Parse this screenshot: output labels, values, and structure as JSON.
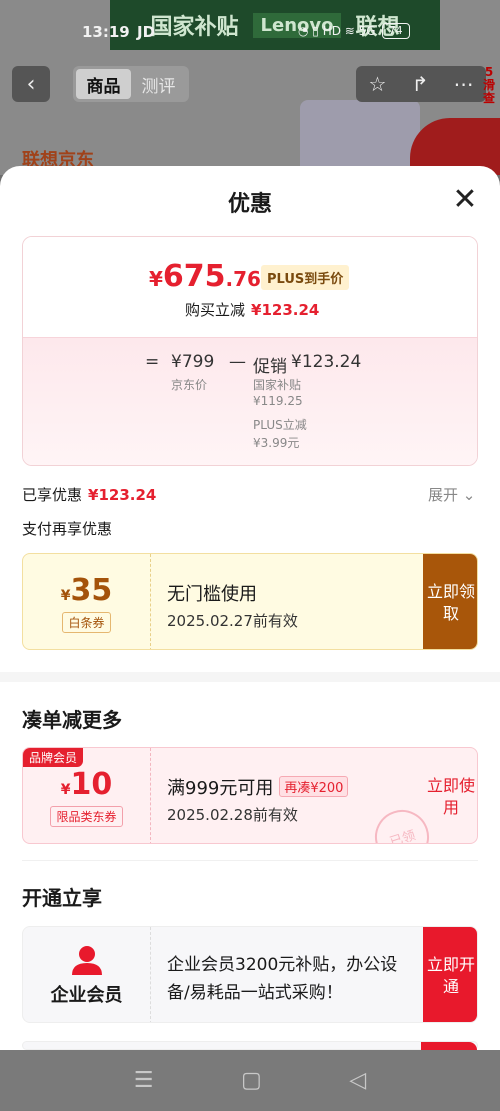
{
  "status_bar": {
    "time": "13:19",
    "carrier": "JD",
    "icons": "◔ ▯ HD ≋ 5G",
    "battery": "74"
  },
  "background": {
    "banner_text": "国家补贴",
    "banner_brand": "Lenovo",
    "banner_brand2": "联想",
    "promo_text": "联想京东",
    "tabs": [
      "商品",
      "测评"
    ],
    "side_badge_num": "5",
    "side_badge_text": "滑查"
  },
  "sheet": {
    "title": "优惠",
    "price": {
      "currency": "¥",
      "integer": "675",
      "decimal": ".76",
      "tag": "PLUS到手价",
      "reduce_label": "购买立减",
      "reduce_value": "¥123.24"
    },
    "breakdown": {
      "equals": "=",
      "base_price": "¥799",
      "base_label": "京东价",
      "minus": "—",
      "promo_label": "促销",
      "promo_value": "¥123.24",
      "items": [
        {
          "name": "国家补贴",
          "value": "¥119.25"
        },
        {
          "name": "PLUS立减",
          "value": "¥3.99元"
        }
      ]
    },
    "enjoyed_label": "已享优惠",
    "enjoyed_value": "¥123.24",
    "expand_label": "展开",
    "pay_more_label": "支付再享优惠",
    "coupon1": {
      "currency": "¥",
      "amount": "35",
      "tag": "白条券",
      "title": "无门槛使用",
      "date": "2025.02.27前有效",
      "button": "立即领取"
    },
    "section2_title": "凑单减更多",
    "coupon2": {
      "brand_tag": "品牌会员",
      "currency": "¥",
      "amount": "10",
      "tag": "限品类东券",
      "title": "满999元可用",
      "reorder_tag": "再凑¥200",
      "date": "2025.02.28前有效",
      "button": "立即使用",
      "stamp": "已领"
    },
    "section3_title": "开通立享",
    "member": {
      "label": "企业会员",
      "desc": "企业会员3200元补贴，办公设备/易耗品一站式采购！",
      "button": "立即开通"
    }
  },
  "colors": {
    "accent_red": "#e5202f",
    "gold": "#a8560a"
  }
}
